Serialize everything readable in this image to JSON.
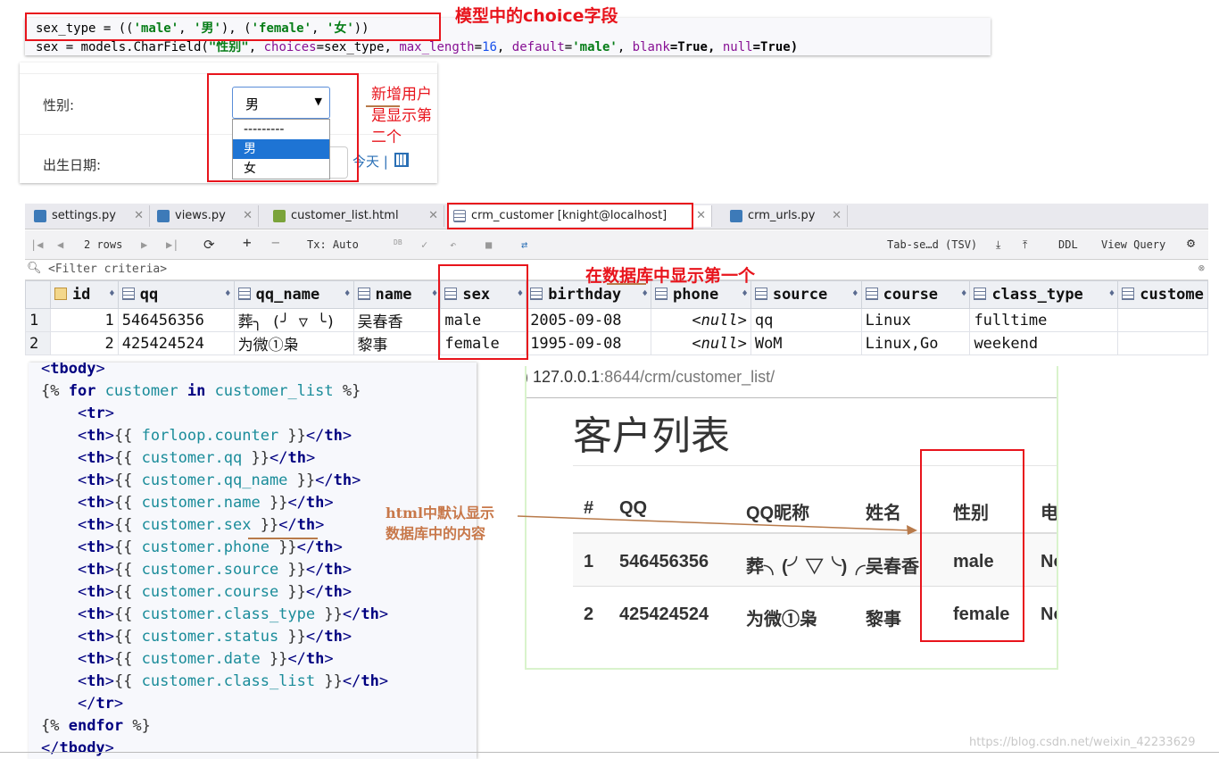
{
  "model_code": {
    "line1": {
      "a": "sex_type = ((",
      "s1": "'male'",
      "b": ", ",
      "s2": "'男'",
      "c": "), (",
      "s3": "'female'",
      "d": ", ",
      "s4": "'女'",
      "e": "))"
    },
    "line2": {
      "a": "sex = models.CharField(",
      "s1": "\"性别\"",
      "b": ", ",
      "p1": "choices",
      "c": "=sex_type, ",
      "p2": "max_length",
      "d": "=",
      "n1": "16",
      "e": ", ",
      "p3": "default",
      "f": "=",
      "s2": "'male'",
      "g": ", ",
      "p4": "blank",
      "h": "=True, ",
      "p5": "null",
      "i": "=True)"
    }
  },
  "annotations": {
    "model_choice": "模型中的choice字段",
    "new_user_line1": "新增用户",
    "new_user_line2": "是显示第",
    "new_user_line3": "二个",
    "db_first": "在数据库中显示第一个",
    "html_line1": "html中默认显示",
    "html_line2": "数据库中的内容"
  },
  "form": {
    "sex_label": "性别:",
    "birth_label": "出生日期:",
    "selected": "男",
    "options": [
      "---------",
      "男",
      "女"
    ],
    "today_link": "今天 |"
  },
  "ide": {
    "tabs": [
      {
        "label": "settings.py",
        "icon": "python-icon"
      },
      {
        "label": "views.py",
        "icon": "python-icon"
      },
      {
        "label": "customer_list.html",
        "icon": "html-icon"
      },
      {
        "label": "crm_customer [knight@localhost]",
        "icon": "table-icon"
      },
      {
        "label": "crm_urls.py",
        "icon": "python-icon"
      }
    ],
    "toolbar": {
      "rows": "2 rows",
      "tx": "Tx: Auto",
      "db": "DB",
      "tab_sep": "Tab-se…d (TSV)",
      "ddl": "DDL",
      "view_query": "View Query"
    },
    "filter_placeholder": "<Filter criteria>",
    "columns": [
      "id",
      "qq",
      "qq_name",
      "name",
      "sex",
      "birthday",
      "phone",
      "source",
      "course",
      "class_type",
      "custome"
    ],
    "rows": [
      [
        "1",
        "1",
        "546456356",
        "葬╮ (╯ ▽ ╰)",
        "吴春香",
        "male",
        "2005-09-08",
        "<null>",
        "qq",
        "Linux",
        "fulltime",
        ""
      ],
      [
        "2",
        "2",
        "425424524",
        "为微①枭",
        "黎事",
        "female",
        "1995-09-08",
        "<null>",
        "WoM",
        "Linux,Go",
        "weekend",
        ""
      ]
    ]
  },
  "template": {
    "lines": [
      {
        "parts": [
          [
            "tag",
            "<"
          ],
          [
            "tk",
            "tbody"
          ],
          [
            "tag",
            ">"
          ]
        ]
      },
      {
        "parts": [
          [
            "plain",
            "{% "
          ],
          [
            "tk",
            "for"
          ],
          [
            "plain",
            " "
          ],
          [
            "var",
            "customer"
          ],
          [
            "plain",
            " "
          ],
          [
            "tk",
            "in"
          ],
          [
            "plain",
            " "
          ],
          [
            "var",
            "customer_list"
          ],
          [
            "plain",
            " %}"
          ]
        ]
      },
      {
        "parts": [
          [
            "plain",
            "    "
          ],
          [
            "tag",
            "<"
          ],
          [
            "tk",
            "tr"
          ],
          [
            "tag",
            ">"
          ]
        ]
      },
      {
        "parts": [
          [
            "plain",
            "    "
          ],
          [
            "tag",
            "<"
          ],
          [
            "tk",
            "th"
          ],
          [
            "tag",
            ">"
          ],
          [
            "plain",
            "{{ "
          ],
          [
            "var",
            "forloop.counter"
          ],
          [
            "plain",
            " }}"
          ],
          [
            "tag",
            "</"
          ],
          [
            "tk",
            "th"
          ],
          [
            "tag",
            ">"
          ]
        ]
      },
      {
        "parts": [
          [
            "plain",
            "    "
          ],
          [
            "tag",
            "<"
          ],
          [
            "tk",
            "th"
          ],
          [
            "tag",
            ">"
          ],
          [
            "plain",
            "{{ "
          ],
          [
            "var",
            "customer.qq"
          ],
          [
            "plain",
            " }}"
          ],
          [
            "tag",
            "</"
          ],
          [
            "tk",
            "th"
          ],
          [
            "tag",
            ">"
          ]
        ]
      },
      {
        "parts": [
          [
            "plain",
            "    "
          ],
          [
            "tag",
            "<"
          ],
          [
            "tk",
            "th"
          ],
          [
            "tag",
            ">"
          ],
          [
            "plain",
            "{{ "
          ],
          [
            "var",
            "customer.qq_name"
          ],
          [
            "plain",
            " }}"
          ],
          [
            "tag",
            "</"
          ],
          [
            "tk",
            "th"
          ],
          [
            "tag",
            ">"
          ]
        ]
      },
      {
        "parts": [
          [
            "plain",
            "    "
          ],
          [
            "tag",
            "<"
          ],
          [
            "tk",
            "th"
          ],
          [
            "tag",
            ">"
          ],
          [
            "plain",
            "{{ "
          ],
          [
            "var",
            "customer.name"
          ],
          [
            "plain",
            " }}"
          ],
          [
            "tag",
            "</"
          ],
          [
            "tk",
            "th"
          ],
          [
            "tag",
            ">"
          ]
        ]
      },
      {
        "parts": [
          [
            "plain",
            "    "
          ],
          [
            "tag",
            "<"
          ],
          [
            "tk",
            "th"
          ],
          [
            "tag",
            ">"
          ],
          [
            "plain",
            "{{ "
          ],
          [
            "var",
            "customer.sex"
          ],
          [
            "plain",
            " }}"
          ],
          [
            "tag",
            "</"
          ],
          [
            "tk",
            "th"
          ],
          [
            "tag",
            ">"
          ]
        ]
      },
      {
        "parts": [
          [
            "plain",
            "    "
          ],
          [
            "tag",
            "<"
          ],
          [
            "tk",
            "th"
          ],
          [
            "tag",
            ">"
          ],
          [
            "plain",
            "{{ "
          ],
          [
            "var",
            "customer.phone"
          ],
          [
            "plain",
            " }}"
          ],
          [
            "tag",
            "</"
          ],
          [
            "tk",
            "th"
          ],
          [
            "tag",
            ">"
          ]
        ]
      },
      {
        "parts": [
          [
            "plain",
            "    "
          ],
          [
            "tag",
            "<"
          ],
          [
            "tk",
            "th"
          ],
          [
            "tag",
            ">"
          ],
          [
            "plain",
            "{{ "
          ],
          [
            "var",
            "customer.source"
          ],
          [
            "plain",
            " }}"
          ],
          [
            "tag",
            "</"
          ],
          [
            "tk",
            "th"
          ],
          [
            "tag",
            ">"
          ]
        ]
      },
      {
        "parts": [
          [
            "plain",
            "    "
          ],
          [
            "tag",
            "<"
          ],
          [
            "tk",
            "th"
          ],
          [
            "tag",
            ">"
          ],
          [
            "plain",
            "{{ "
          ],
          [
            "var",
            "customer.course"
          ],
          [
            "plain",
            " }}"
          ],
          [
            "tag",
            "</"
          ],
          [
            "tk",
            "th"
          ],
          [
            "tag",
            ">"
          ]
        ]
      },
      {
        "parts": [
          [
            "plain",
            "    "
          ],
          [
            "tag",
            "<"
          ],
          [
            "tk",
            "th"
          ],
          [
            "tag",
            ">"
          ],
          [
            "plain",
            "{{ "
          ],
          [
            "var",
            "customer.class_type"
          ],
          [
            "plain",
            " }}"
          ],
          [
            "tag",
            "</"
          ],
          [
            "tk",
            "th"
          ],
          [
            "tag",
            ">"
          ]
        ]
      },
      {
        "parts": [
          [
            "plain",
            "    "
          ],
          [
            "tag",
            "<"
          ],
          [
            "tk",
            "th"
          ],
          [
            "tag",
            ">"
          ],
          [
            "plain",
            "{{ "
          ],
          [
            "var",
            "customer.status"
          ],
          [
            "plain",
            " }}"
          ],
          [
            "tag",
            "</"
          ],
          [
            "tk",
            "th"
          ],
          [
            "tag",
            ">"
          ]
        ]
      },
      {
        "parts": [
          [
            "plain",
            "    "
          ],
          [
            "tag",
            "<"
          ],
          [
            "tk",
            "th"
          ],
          [
            "tag",
            ">"
          ],
          [
            "plain",
            "{{ "
          ],
          [
            "var",
            "customer.date"
          ],
          [
            "plain",
            " }}"
          ],
          [
            "tag",
            "</"
          ],
          [
            "tk",
            "th"
          ],
          [
            "tag",
            ">"
          ]
        ]
      },
      {
        "parts": [
          [
            "plain",
            "    "
          ],
          [
            "tag",
            "<"
          ],
          [
            "tk",
            "th"
          ],
          [
            "tag",
            ">"
          ],
          [
            "plain",
            "{{ "
          ],
          [
            "var",
            "customer.class_list"
          ],
          [
            "plain",
            " }}"
          ],
          [
            "tag",
            "</"
          ],
          [
            "tk",
            "th"
          ],
          [
            "tag",
            ">"
          ]
        ]
      },
      {
        "parts": [
          [
            "plain",
            "    "
          ],
          [
            "tag",
            "</"
          ],
          [
            "tk",
            "tr"
          ],
          [
            "tag",
            ">"
          ]
        ]
      },
      {
        "parts": [
          [
            "plain",
            "{% "
          ],
          [
            "tk",
            "endfor"
          ],
          [
            "plain",
            " %}"
          ]
        ]
      },
      {
        "parts": [
          [
            "tag",
            "</"
          ],
          [
            "tk",
            "tbody"
          ],
          [
            "tag",
            ">"
          ]
        ]
      }
    ]
  },
  "browser": {
    "url_host": "127.0.0.1",
    "url_rest": ":8644/crm/customer_list/",
    "heading": "客户列表",
    "headers": [
      "#",
      "QQ",
      "QQ昵称",
      "姓名",
      "性别",
      "电"
    ],
    "rows": [
      [
        "1",
        "546456356",
        "葬╮(╯▽╰)╭",
        "吴春香",
        "male",
        "No"
      ],
      [
        "2",
        "425424524",
        "为微①枭",
        "黎事",
        "female",
        "No"
      ]
    ]
  },
  "watermark": "https://blog.csdn.net/weixin_42233629"
}
